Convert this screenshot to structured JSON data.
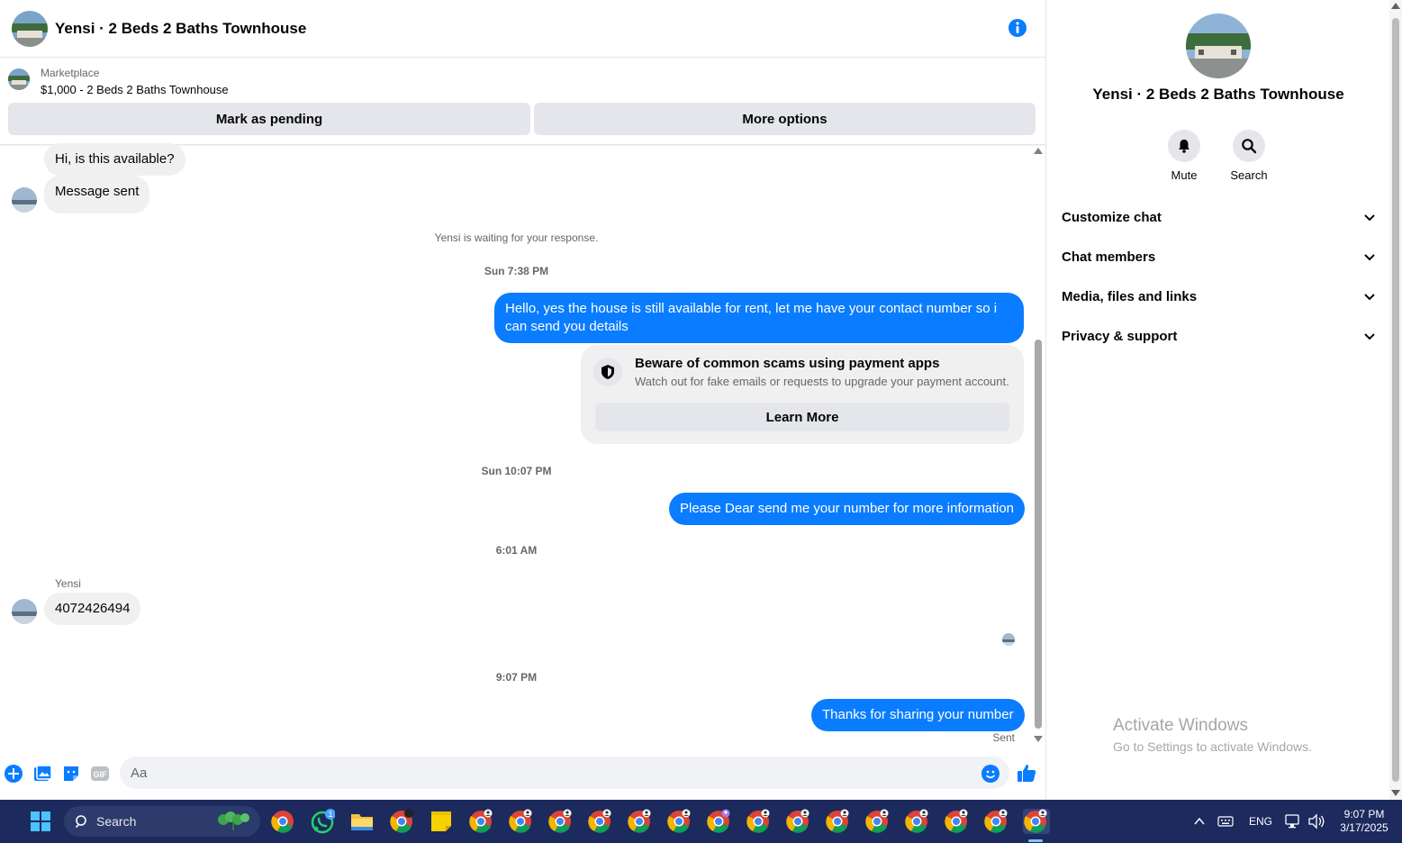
{
  "header": {
    "title": "Yensi · 2 Beds 2 Baths Townhouse"
  },
  "marketplace": {
    "label": "Marketplace",
    "listing": "$1,000 - 2 Beds 2 Baths Townhouse",
    "pending_button": "Mark as pending",
    "more_button": "More options"
  },
  "messages": {
    "m1": "Hi, is this available?",
    "m2": "Message sent",
    "waiting": "Yensi is waiting for your response.",
    "ts1": "Sun 7:38 PM",
    "m3": "Hello, yes the house is still available for rent, let me have your contact number so i can send you  details",
    "scam_title": "Beware of common scams using payment apps",
    "scam_text": "Watch out for fake emails or requests to upgrade your payment account.",
    "learn_more": "Learn More",
    "ts2": "Sun 10:07 PM",
    "m4": "Please Dear send me your number for more information",
    "ts3": "6:01 AM",
    "sender": "Yensi",
    "m5": "4072426494",
    "ts4": "9:07 PM",
    "m6": "Thanks for sharing your number",
    "status": "Sent"
  },
  "composer": {
    "placeholder": "Aa"
  },
  "info_panel": {
    "title": "Yensi · 2 Beds 2 Baths Townhouse",
    "mute": "Mute",
    "search": "Search",
    "sections": [
      "Customize chat",
      "Chat members",
      "Media, files and links",
      "Privacy & support"
    ]
  },
  "watermark": {
    "line1": "Activate Windows",
    "line2": "Go to Settings to activate Windows."
  },
  "taskbar": {
    "search": "Search",
    "whatsapp_badge": "1",
    "lang": "ENG",
    "time": "9:07 PM",
    "date": "3/17/2025"
  },
  "colors": {
    "accent": "#0a7cff",
    "taskbar": "#1c2a5e"
  }
}
